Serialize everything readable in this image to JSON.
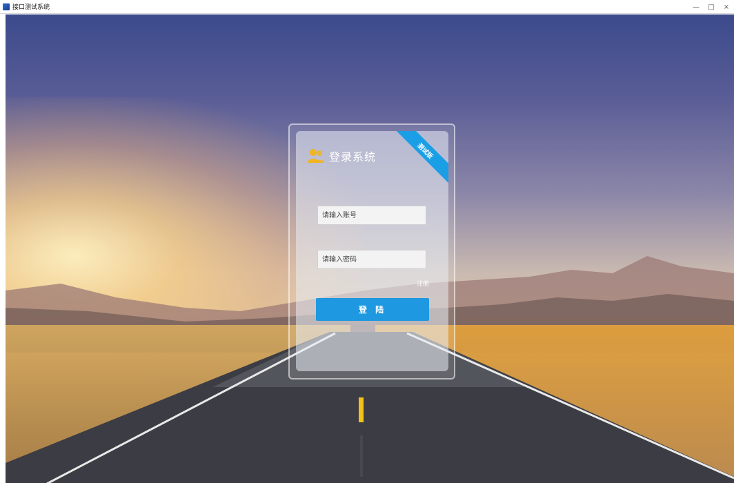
{
  "window": {
    "title": "接口测试系统",
    "controls": {
      "minimize": "—",
      "maximize": "□",
      "close": "×"
    }
  },
  "login": {
    "title": "登录系统",
    "ribbon": "测试版",
    "username_placeholder": "请输入账号",
    "password_placeholder": "请输入密码",
    "register_label": "注册",
    "submit_label": "登 陆"
  },
  "colors": {
    "accent": "#1e98e0",
    "ribbon": "#1a9fe6",
    "user_icon": "#f2b51f"
  },
  "icons": {
    "app": "app-icon",
    "user": "user-group-icon"
  }
}
